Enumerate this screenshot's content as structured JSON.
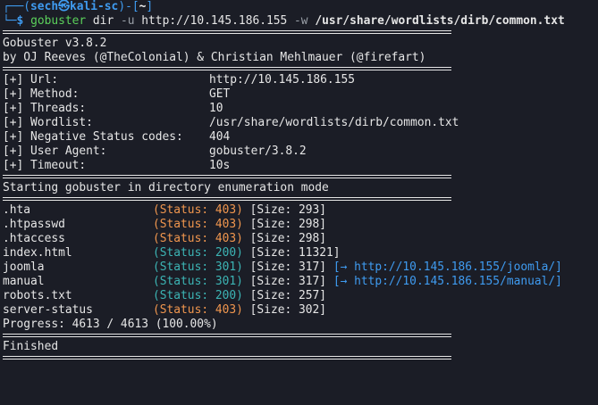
{
  "prompt": {
    "corner_top": "┌──(",
    "user_host": "sech㉿kali-sc",
    "mid": ")-[",
    "path": "~",
    "end": "]",
    "corner_bottom": "└─",
    "symbol": "$",
    "command": "gobuster",
    "args_1": "dir",
    "flag_u": "-u",
    "url": "http://10.145.186.155",
    "flag_w": "-w",
    "wordlist": "/usr/share/wordlists/dirb/common.txt"
  },
  "banner": {
    "title": "Gobuster v3.8.2",
    "credits": "by OJ Reeves (@TheColonial) & Christian Mehlmauer (@firefart)"
  },
  "config": [
    {
      "label": "[+] Url:",
      "value": "http://10.145.186.155"
    },
    {
      "label": "[+] Method:",
      "value": "GET"
    },
    {
      "label": "[+] Threads:",
      "value": "10"
    },
    {
      "label": "[+] Wordlist:",
      "value": "/usr/share/wordlists/dirb/common.txt"
    },
    {
      "label": "[+] Negative Status codes:",
      "value": "404"
    },
    {
      "label": "[+] User Agent:",
      "value": "gobuster/3.8.2"
    },
    {
      "label": "[+] Timeout:",
      "value": "10s"
    }
  ],
  "start_message": "Starting gobuster in directory enumeration mode",
  "results": [
    {
      "path": ".hta",
      "status": "(Status: 403)",
      "size": "[Size: 293]",
      "redirect": ""
    },
    {
      "path": ".htpasswd",
      "status": "(Status: 403)",
      "size": "[Size: 298]",
      "redirect": ""
    },
    {
      "path": ".htaccess",
      "status": "(Status: 403)",
      "size": "[Size: 298]",
      "redirect": ""
    },
    {
      "path": "index.html",
      "status": "(Status: 200)",
      "size": "[Size: 11321]",
      "redirect": ""
    },
    {
      "path": "joomla",
      "status": "(Status: 301)",
      "size": "[Size: 317]",
      "redirect": "[→ http://10.145.186.155/joomla/]"
    },
    {
      "path": "manual",
      "status": "(Status: 301)",
      "size": "[Size: 317]",
      "redirect": "[→ http://10.145.186.155/manual/]"
    },
    {
      "path": "robots.txt",
      "status": "(Status: 200)",
      "size": "[Size: 257]",
      "redirect": ""
    },
    {
      "path": "server-status",
      "status": "(Status: 403)",
      "size": "[Size: 302]",
      "redirect": ""
    }
  ],
  "progress": "Progress: 4613 / 4613 (100.00%)",
  "finished": "Finished",
  "colors": {
    "background": "#1b1d26",
    "prompt_blue": "#3f9bf0",
    "prompt_green": "#5bd15b",
    "status_403": "#f0964e",
    "status_2xx_3xx": "#3cb4b4",
    "redirect_link": "#3f9bf0"
  }
}
